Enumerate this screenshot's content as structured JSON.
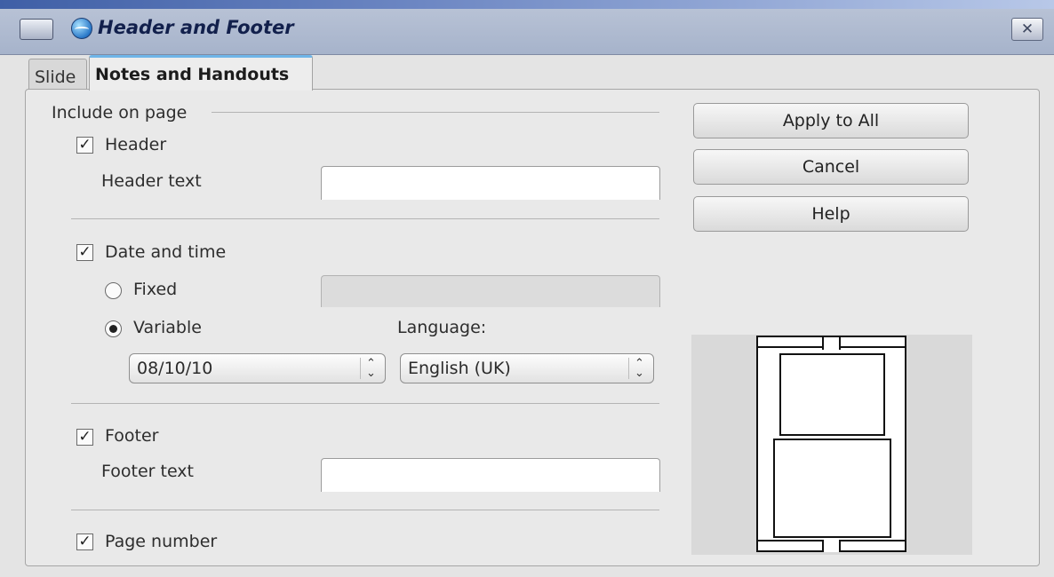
{
  "window": {
    "title": "Header and Footer",
    "close_glyph": "✕"
  },
  "tabs": [
    {
      "label": "Slide"
    },
    {
      "label": "Notes and Handouts"
    }
  ],
  "include_on_page": {
    "group_label": "Include on page",
    "header": {
      "checkbox_label": "Header",
      "checked": true,
      "text_label": "Header text",
      "text_value": ""
    },
    "date_time": {
      "checkbox_label": "Date and time",
      "checked": true,
      "fixed_label": "Fixed",
      "fixed_value": "",
      "variable_label": "Variable",
      "variable_selected": true,
      "variable_value": "08/10/10",
      "language_label": "Language:",
      "language_value": "English (UK)"
    },
    "footer": {
      "checkbox_label": "Footer",
      "checked": true,
      "text_label": "Footer text",
      "text_value": ""
    },
    "page_number": {
      "checkbox_label": "Page number",
      "checked": true
    }
  },
  "buttons": {
    "apply_all": "Apply to All",
    "cancel": "Cancel",
    "help": "Help"
  },
  "glyphs": {
    "check": "✓",
    "spin": "⌃⌄"
  }
}
